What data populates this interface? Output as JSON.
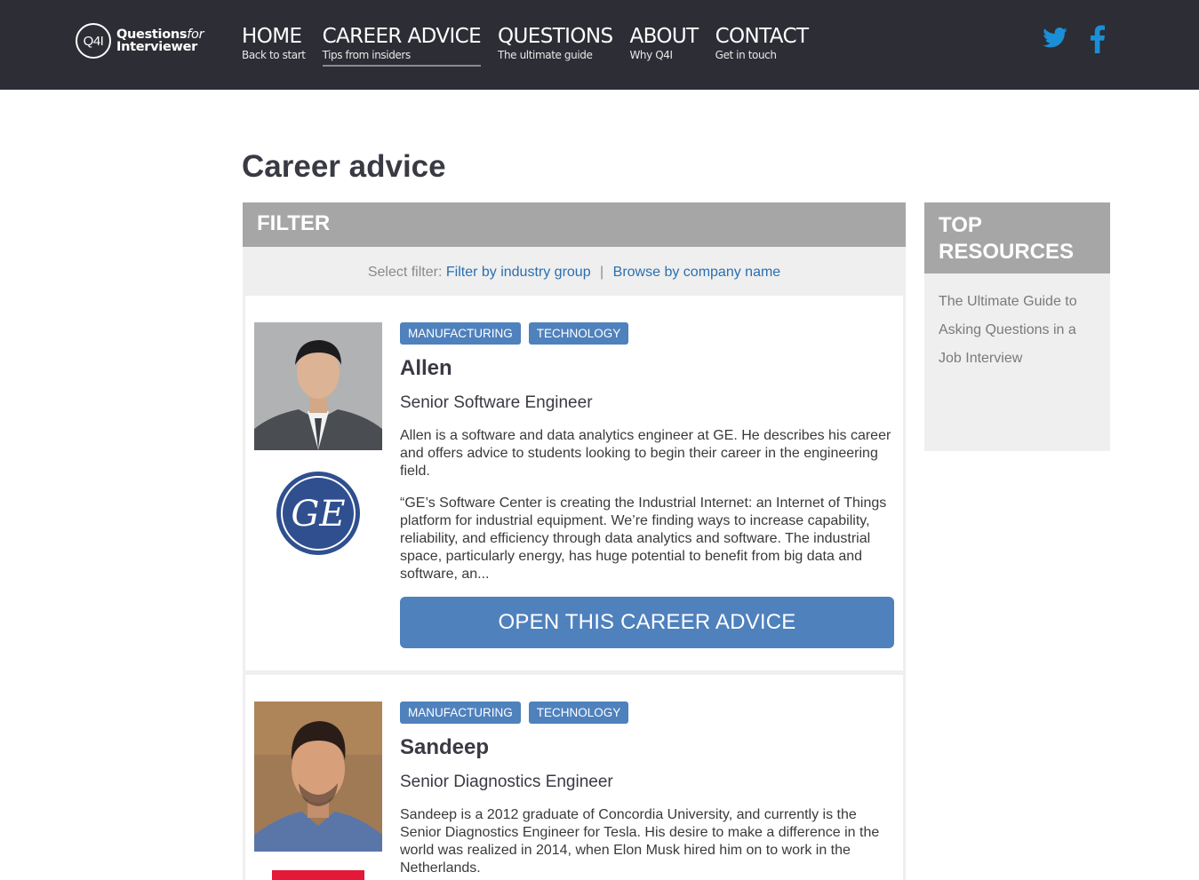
{
  "header": {
    "logo_mark": "Q4I",
    "logo_line1_a": "Questions",
    "logo_line1_b": "for",
    "logo_line2": "Interviewer",
    "nav": [
      {
        "label": "HOME",
        "sub": "Back to start"
      },
      {
        "label": "CAREER ADVICE",
        "sub": "Tips from insiders"
      },
      {
        "label": "QUESTIONS",
        "sub": "The ultimate guide"
      },
      {
        "label": "ABOUT",
        "sub": "Why Q4I"
      },
      {
        "label": "CONTACT",
        "sub": "Get in touch"
      }
    ],
    "social": [
      "twitter-icon",
      "facebook-icon"
    ],
    "colors": {
      "bg": "#2d2d35",
      "social": "#1b8fd6"
    }
  },
  "page": {
    "title": "Career advice"
  },
  "filter": {
    "heading": "FILTER",
    "select_label": "Select filter:",
    "option1": "Filter by industry group",
    "separator": "|",
    "option2": "Browse by company name"
  },
  "cards": [
    {
      "tags": [
        "MANUFACTURING",
        "TECHNOLOGY"
      ],
      "name": "Allen",
      "role": "Senior Software Engineer",
      "summary": "Allen is a software and data analytics engineer at GE. He describes his career and offers advice to students looking to begin their career in the engineering field.",
      "quote": "“GE’s Software Center is creating the Industrial Internet: an Internet of Things platform for industrial equipment. We’re finding ways to increase capability, reliability, and efficiency through data analytics and software. The industrial space, particularly energy, has huge potential to benefit from big data and software, an...",
      "button": "OPEN THIS CAREER ADVICE",
      "company_logo": "GE"
    },
    {
      "tags": [
        "MANUFACTURING",
        "TECHNOLOGY"
      ],
      "name": "Sandeep",
      "role": "Senior Diagnostics Engineer",
      "summary": "Sandeep is a 2012 graduate of Concordia University, and currently is the Senior Diagnostics Engineer for Tesla. His desire to make a difference in the world was realized in 2014, when Elon Musk hired him on to work in the Netherlands."
    }
  ],
  "sidebar": {
    "heading": "TOP RESOURCES",
    "link": "The Ultimate Guide to Asking Questions in a Job Interview"
  },
  "accent": "#4f81bd"
}
